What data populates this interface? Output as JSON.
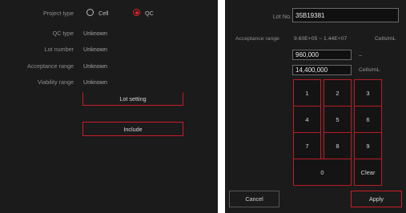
{
  "left": {
    "project_type_label": "Project type",
    "option_cell": "Cell",
    "option_qc": "QC",
    "selected_option": "QC",
    "qc_type_label": "QC type",
    "qc_type_value": "Unknown",
    "lot_number_label": "Lot number",
    "lot_number_value": "Unknown",
    "acceptance_range_label": "Acceptance range",
    "acceptance_range_value": "Unknown",
    "viability_range_label": "Viability range",
    "viability_range_value": "Unknown",
    "lot_setting_button": "Lot setting",
    "include_button": "Include"
  },
  "right": {
    "lot_no_label": "Lot No.",
    "lot_no_value": "35B19381",
    "acceptance_range_label": "Acceptance range",
    "acceptance_range_value": "9.60E+05 ~ 1.44E+07",
    "acceptance_range_unit": "Cells/mL",
    "min_value": "960,000",
    "range_separator": "~",
    "max_value": "14,400,000",
    "max_unit": "Cells/mL",
    "keypad": {
      "k1": "1",
      "k2": "2",
      "k3": "3",
      "k4": "4",
      "k5": "5",
      "k6": "6",
      "k7": "7",
      "k8": "8",
      "k9": "9",
      "k0": "0",
      "clear": "Clear"
    },
    "cancel_button": "Cancel",
    "apply_button": "Apply"
  },
  "colors": {
    "accent_red": "#e0202a",
    "panel_bg": "#1b1b1b"
  }
}
